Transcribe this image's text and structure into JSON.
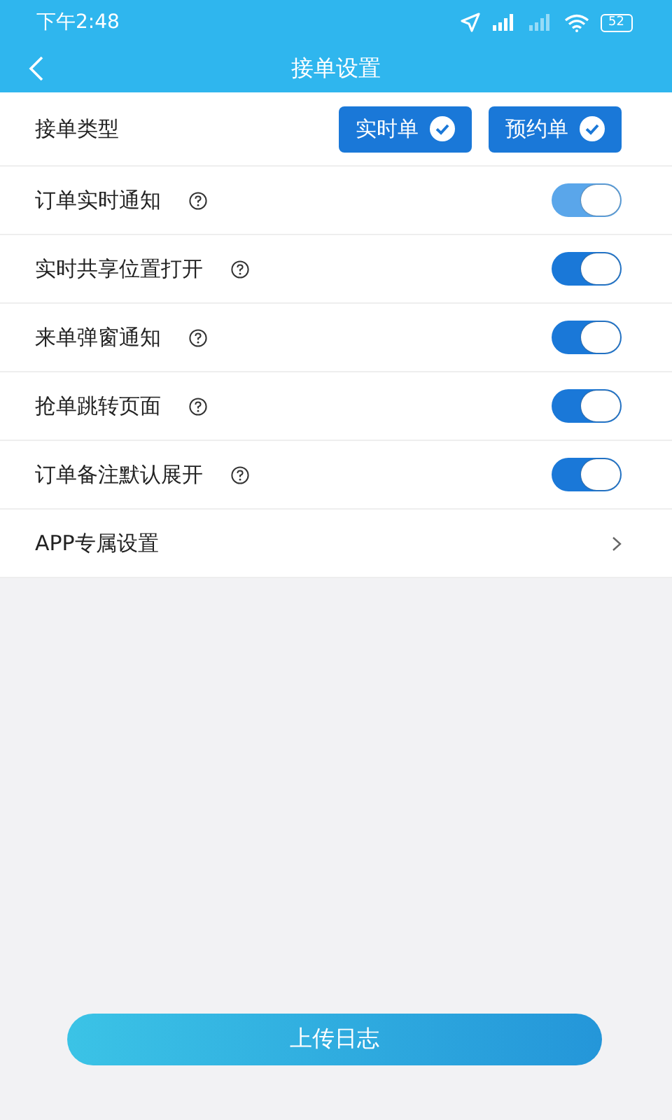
{
  "status_bar": {
    "time": "下午2:48",
    "battery": "52"
  },
  "header": {
    "title": "接单设置"
  },
  "order_type": {
    "label": "接单类型",
    "options": [
      {
        "label": "实时单",
        "checked": true
      },
      {
        "label": "预约单",
        "checked": true
      }
    ]
  },
  "settings": [
    {
      "label": "订单实时通知",
      "on": true,
      "disabled": true
    },
    {
      "label": "实时共享位置打开",
      "on": true,
      "disabled": false
    },
    {
      "label": "来单弹窗通知",
      "on": true,
      "disabled": false
    },
    {
      "label": "抢单跳转页面",
      "on": true,
      "disabled": false
    },
    {
      "label": "订单备注默认展开",
      "on": true,
      "disabled": false
    }
  ],
  "app_settings": {
    "label": "APP专属设置"
  },
  "upload_button": {
    "label": "上传日志"
  }
}
